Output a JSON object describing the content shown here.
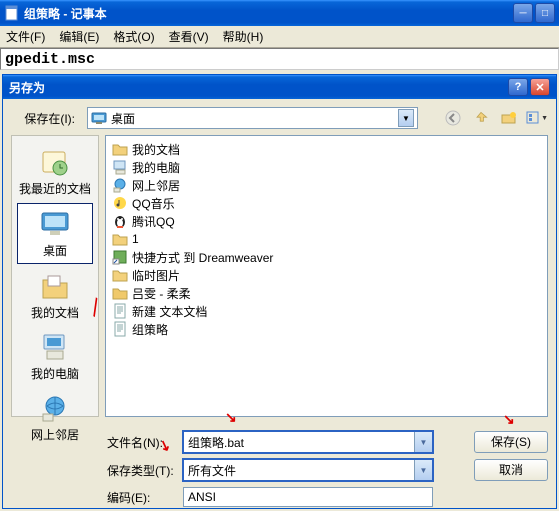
{
  "window": {
    "title": "组策略 - 记事本",
    "menu": {
      "file": "文件(F)",
      "edit": "编辑(E)",
      "format": "格式(O)",
      "view": "查看(V)",
      "help": "帮助(H)"
    },
    "content": "gpedit.msc"
  },
  "dialog": {
    "title": "另存为",
    "savein_label": "保存在(I):",
    "savein_value": "桌面",
    "places": {
      "recent": "我最近的文档",
      "desktop": "桌面",
      "mydocs": "我的文档",
      "mycomputer": "我的电脑",
      "network": "网上邻居"
    },
    "files": [
      {
        "icon": "folder",
        "name": "我的文档"
      },
      {
        "icon": "computer",
        "name": "我的电脑"
      },
      {
        "icon": "network",
        "name": "网上邻居"
      },
      {
        "icon": "music",
        "name": "QQ音乐"
      },
      {
        "icon": "qq",
        "name": "腾讯QQ"
      },
      {
        "icon": "folder",
        "name": "1"
      },
      {
        "icon": "shortcut",
        "name": "快捷方式 到 Dreamweaver"
      },
      {
        "icon": "folder",
        "name": "临时图片"
      },
      {
        "icon": "folder-small",
        "name": "吕雯 - 柔柔"
      },
      {
        "icon": "textfile",
        "name": "新建 文本文档"
      },
      {
        "icon": "textfile",
        "name": "组策略"
      }
    ],
    "filename_label": "文件名(N):",
    "filename_value": "组策略.bat",
    "filetype_label": "保存类型(T):",
    "filetype_value": "所有文件",
    "encoding_label": "编码(E):",
    "encoding_value": "ANSI",
    "save_btn": "保存(S)",
    "cancel_btn": "取消"
  }
}
